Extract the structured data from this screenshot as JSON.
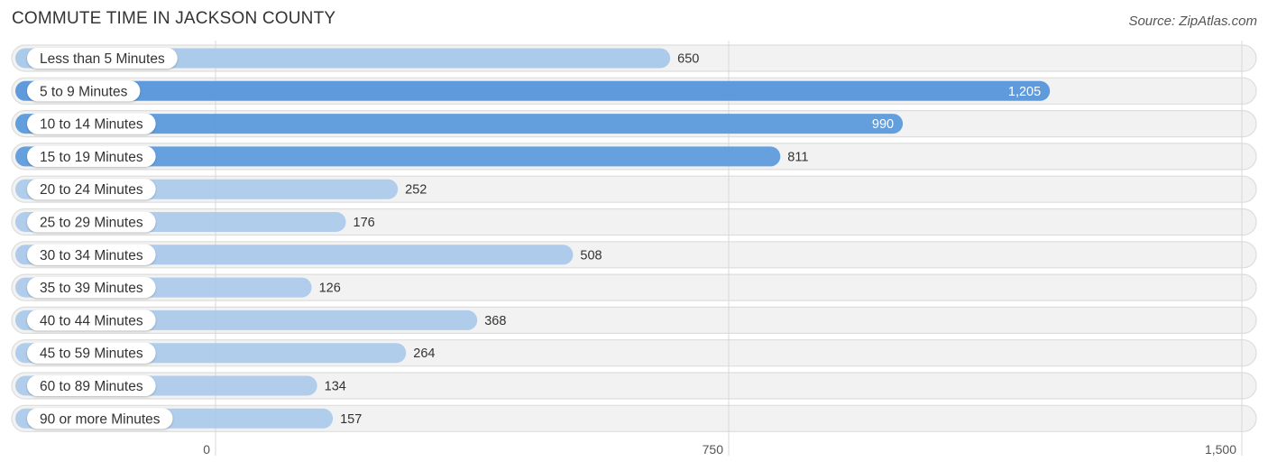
{
  "header": {
    "title": "COMMUTE TIME IN JACKSON COUNTY",
    "source": "Source: ZipAtlas.com"
  },
  "colors": {
    "bar_strong": "#5f9bdc",
    "bar_light": "#a7c7ea",
    "track": "#f2f2f2",
    "track_border": "#dddddd",
    "grid": "#d8d8d8"
  },
  "chart_data": {
    "type": "bar",
    "orientation": "horizontal",
    "title": "COMMUTE TIME IN JACKSON COUNTY",
    "xlabel": "",
    "ylabel": "",
    "xlim": [
      0,
      1500
    ],
    "x_ticks": [
      0,
      750,
      1500
    ],
    "x_tick_labels": [
      "0",
      "750",
      "1,500"
    ],
    "grid": true,
    "categories": [
      "Less than 5 Minutes",
      "5 to 9 Minutes",
      "10 to 14 Minutes",
      "15 to 19 Minutes",
      "20 to 24 Minutes",
      "25 to 29 Minutes",
      "30 to 34 Minutes",
      "35 to 39 Minutes",
      "40 to 44 Minutes",
      "45 to 59 Minutes",
      "60 to 89 Minutes",
      "90 or more Minutes"
    ],
    "values": [
      650,
      1205,
      990,
      811,
      252,
      176,
      508,
      126,
      368,
      264,
      134,
      157
    ],
    "value_labels": [
      "650",
      "1,205",
      "990",
      "811",
      "252",
      "176",
      "508",
      "126",
      "368",
      "264",
      "134",
      "157"
    ]
  }
}
